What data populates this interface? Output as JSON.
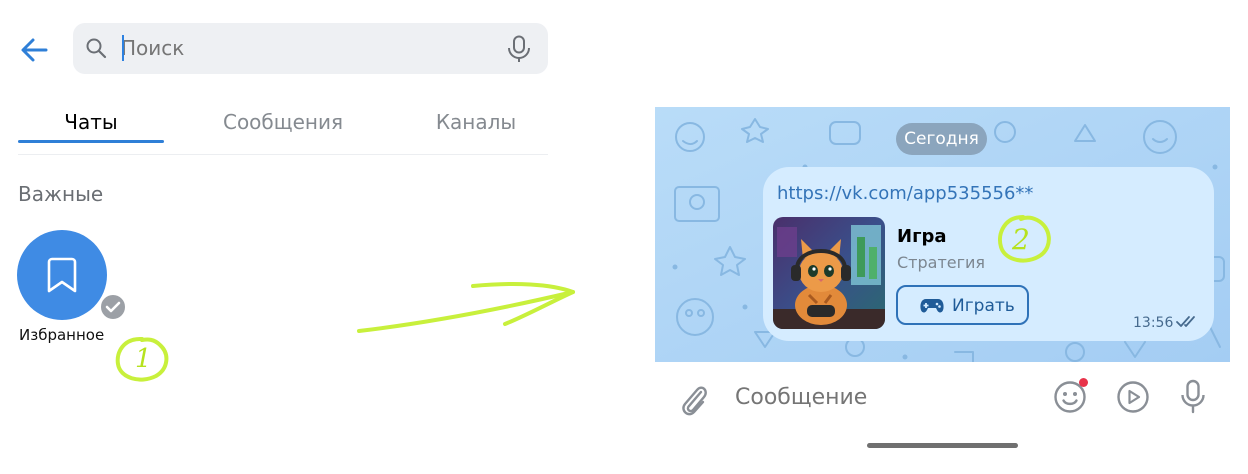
{
  "search": {
    "placeholder": "Поиск"
  },
  "tabs": [
    {
      "label": "Чаты",
      "active": true
    },
    {
      "label": "Сообщения",
      "active": false
    },
    {
      "label": "Каналы",
      "active": false
    }
  ],
  "section": {
    "title": "Важные"
  },
  "favorites": {
    "label": "Избранное"
  },
  "annotations": {
    "step1": "1",
    "step2": "2"
  },
  "chat": {
    "date": "Сегодня",
    "message": {
      "link": "https://vk.com/app535556**",
      "game_title": "Игра",
      "game_genre": "Стратегия",
      "play_label": "Играть",
      "time": "13:56"
    }
  },
  "composer": {
    "placeholder": "Сообщение"
  },
  "colors": {
    "accent": "#2f7fd7",
    "bubble": "#d5ecff",
    "chat_bg": "#a9d0f5",
    "annotation": "#c8f03c"
  },
  "icons": [
    "back-arrow-icon",
    "search-icon",
    "mic-icon",
    "bookmark-icon",
    "check-icon",
    "gamepad-icon",
    "double-check-icon",
    "paperclip-icon",
    "emoji-icon",
    "video-message-icon"
  ]
}
